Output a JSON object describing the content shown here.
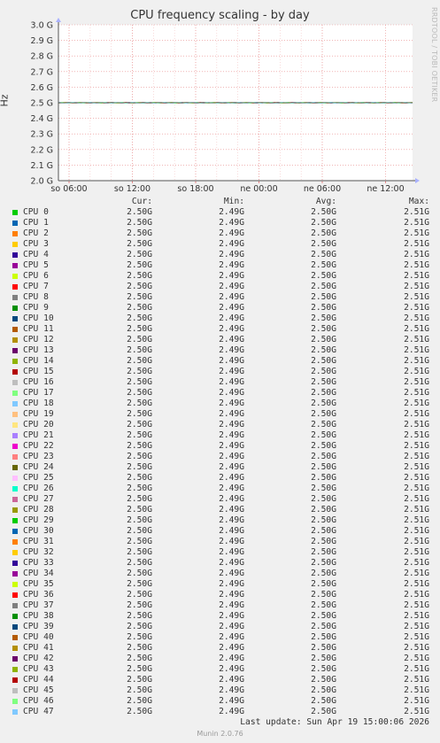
{
  "chart_data": {
    "type": "line",
    "title": "CPU frequency scaling - by day",
    "ylabel": "Hz",
    "ylim": [
      2.0,
      3.0
    ],
    "yticks": [
      {
        "v": 3.0,
        "label": "3.0 G"
      },
      {
        "v": 2.9,
        "label": "2.9 G"
      },
      {
        "v": 2.8,
        "label": "2.8 G"
      },
      {
        "v": 2.7,
        "label": "2.7 G"
      },
      {
        "v": 2.6,
        "label": "2.6 G"
      },
      {
        "v": 2.5,
        "label": "2.5 G"
      },
      {
        "v": 2.4,
        "label": "2.4 G"
      },
      {
        "v": 2.3,
        "label": "2.3 G"
      },
      {
        "v": 2.2,
        "label": "2.2 G"
      },
      {
        "v": 2.1,
        "label": "2.1 G"
      },
      {
        "v": 2.0,
        "label": "2.0 G"
      }
    ],
    "xticks": [
      "so 06:00",
      "so 12:00",
      "so 18:00",
      "ne 00:00",
      "ne 06:00",
      "ne 12:00"
    ],
    "side_label": "RRDTOOL / TOBI OETIKER",
    "columns": {
      "cur": "Cur:",
      "min": "Min:",
      "avg": "Avg:",
      "max": "Max:"
    },
    "series": [
      {
        "name": "CPU 0",
        "color": "#00cc00",
        "cur": "2.50G",
        "min": "2.49G",
        "avg": "2.50G",
        "max": "2.51G"
      },
      {
        "name": "CPU 1",
        "color": "#0066b3",
        "cur": "2.50G",
        "min": "2.49G",
        "avg": "2.50G",
        "max": "2.51G"
      },
      {
        "name": "CPU 2",
        "color": "#ff8000",
        "cur": "2.50G",
        "min": "2.49G",
        "avg": "2.50G",
        "max": "2.51G"
      },
      {
        "name": "CPU 3",
        "color": "#ffcc00",
        "cur": "2.50G",
        "min": "2.49G",
        "avg": "2.50G",
        "max": "2.51G"
      },
      {
        "name": "CPU 4",
        "color": "#330099",
        "cur": "2.50G",
        "min": "2.49G",
        "avg": "2.50G",
        "max": "2.51G"
      },
      {
        "name": "CPU 5",
        "color": "#990099",
        "cur": "2.50G",
        "min": "2.49G",
        "avg": "2.50G",
        "max": "2.51G"
      },
      {
        "name": "CPU 6",
        "color": "#ccff00",
        "cur": "2.50G",
        "min": "2.49G",
        "avg": "2.50G",
        "max": "2.51G"
      },
      {
        "name": "CPU 7",
        "color": "#ff0000",
        "cur": "2.50G",
        "min": "2.49G",
        "avg": "2.50G",
        "max": "2.51G"
      },
      {
        "name": "CPU 8",
        "color": "#808080",
        "cur": "2.50G",
        "min": "2.49G",
        "avg": "2.50G",
        "max": "2.51G"
      },
      {
        "name": "CPU 9",
        "color": "#008f00",
        "cur": "2.50G",
        "min": "2.49G",
        "avg": "2.50G",
        "max": "2.51G"
      },
      {
        "name": "CPU 10",
        "color": "#00487d",
        "cur": "2.50G",
        "min": "2.49G",
        "avg": "2.50G",
        "max": "2.51G"
      },
      {
        "name": "CPU 11",
        "color": "#b35a00",
        "cur": "2.50G",
        "min": "2.49G",
        "avg": "2.50G",
        "max": "2.51G"
      },
      {
        "name": "CPU 12",
        "color": "#b38f00",
        "cur": "2.50G",
        "min": "2.49G",
        "avg": "2.50G",
        "max": "2.51G"
      },
      {
        "name": "CPU 13",
        "color": "#6b006b",
        "cur": "2.50G",
        "min": "2.49G",
        "avg": "2.50G",
        "max": "2.51G"
      },
      {
        "name": "CPU 14",
        "color": "#8fb300",
        "cur": "2.50G",
        "min": "2.49G",
        "avg": "2.50G",
        "max": "2.51G"
      },
      {
        "name": "CPU 15",
        "color": "#b30000",
        "cur": "2.50G",
        "min": "2.49G",
        "avg": "2.50G",
        "max": "2.51G"
      },
      {
        "name": "CPU 16",
        "color": "#bebebe",
        "cur": "2.50G",
        "min": "2.49G",
        "avg": "2.50G",
        "max": "2.51G"
      },
      {
        "name": "CPU 17",
        "color": "#80ff80",
        "cur": "2.50G",
        "min": "2.49G",
        "avg": "2.50G",
        "max": "2.51G"
      },
      {
        "name": "CPU 18",
        "color": "#80c9ff",
        "cur": "2.50G",
        "min": "2.49G",
        "avg": "2.50G",
        "max": "2.51G"
      },
      {
        "name": "CPU 19",
        "color": "#ffc080",
        "cur": "2.50G",
        "min": "2.49G",
        "avg": "2.50G",
        "max": "2.51G"
      },
      {
        "name": "CPU 20",
        "color": "#ffe680",
        "cur": "2.50G",
        "min": "2.49G",
        "avg": "2.50G",
        "max": "2.51G"
      },
      {
        "name": "CPU 21",
        "color": "#aa80ff",
        "cur": "2.50G",
        "min": "2.49G",
        "avg": "2.50G",
        "max": "2.51G"
      },
      {
        "name": "CPU 22",
        "color": "#ee00cc",
        "cur": "2.50G",
        "min": "2.49G",
        "avg": "2.50G",
        "max": "2.51G"
      },
      {
        "name": "CPU 23",
        "color": "#ff8080",
        "cur": "2.50G",
        "min": "2.49G",
        "avg": "2.50G",
        "max": "2.51G"
      },
      {
        "name": "CPU 24",
        "color": "#666600",
        "cur": "2.50G",
        "min": "2.49G",
        "avg": "2.50G",
        "max": "2.51G"
      },
      {
        "name": "CPU 25",
        "color": "#ffbfff",
        "cur": "2.50G",
        "min": "2.49G",
        "avg": "2.50G",
        "max": "2.51G"
      },
      {
        "name": "CPU 26",
        "color": "#00ffcc",
        "cur": "2.50G",
        "min": "2.49G",
        "avg": "2.50G",
        "max": "2.51G"
      },
      {
        "name": "CPU 27",
        "color": "#cc6699",
        "cur": "2.50G",
        "min": "2.49G",
        "avg": "2.50G",
        "max": "2.51G"
      },
      {
        "name": "CPU 28",
        "color": "#999900",
        "cur": "2.50G",
        "min": "2.49G",
        "avg": "2.50G",
        "max": "2.51G"
      },
      {
        "name": "CPU 29",
        "color": "#00cc00",
        "cur": "2.50G",
        "min": "2.49G",
        "avg": "2.50G",
        "max": "2.51G"
      },
      {
        "name": "CPU 30",
        "color": "#0066b3",
        "cur": "2.50G",
        "min": "2.49G",
        "avg": "2.50G",
        "max": "2.51G"
      },
      {
        "name": "CPU 31",
        "color": "#ff8000",
        "cur": "2.50G",
        "min": "2.49G",
        "avg": "2.50G",
        "max": "2.51G"
      },
      {
        "name": "CPU 32",
        "color": "#ffcc00",
        "cur": "2.50G",
        "min": "2.49G",
        "avg": "2.50G",
        "max": "2.51G"
      },
      {
        "name": "CPU 33",
        "color": "#330099",
        "cur": "2.50G",
        "min": "2.49G",
        "avg": "2.50G",
        "max": "2.51G"
      },
      {
        "name": "CPU 34",
        "color": "#990099",
        "cur": "2.50G",
        "min": "2.49G",
        "avg": "2.50G",
        "max": "2.51G"
      },
      {
        "name": "CPU 35",
        "color": "#ccff00",
        "cur": "2.50G",
        "min": "2.49G",
        "avg": "2.50G",
        "max": "2.51G"
      },
      {
        "name": "CPU 36",
        "color": "#ff0000",
        "cur": "2.50G",
        "min": "2.49G",
        "avg": "2.50G",
        "max": "2.51G"
      },
      {
        "name": "CPU 37",
        "color": "#808080",
        "cur": "2.50G",
        "min": "2.49G",
        "avg": "2.50G",
        "max": "2.51G"
      },
      {
        "name": "CPU 38",
        "color": "#008f00",
        "cur": "2.50G",
        "min": "2.49G",
        "avg": "2.50G",
        "max": "2.51G"
      },
      {
        "name": "CPU 39",
        "color": "#00487d",
        "cur": "2.50G",
        "min": "2.49G",
        "avg": "2.50G",
        "max": "2.51G"
      },
      {
        "name": "CPU 40",
        "color": "#b35a00",
        "cur": "2.50G",
        "min": "2.49G",
        "avg": "2.50G",
        "max": "2.51G"
      },
      {
        "name": "CPU 41",
        "color": "#b38f00",
        "cur": "2.50G",
        "min": "2.49G",
        "avg": "2.50G",
        "max": "2.51G"
      },
      {
        "name": "CPU 42",
        "color": "#6b006b",
        "cur": "2.50G",
        "min": "2.49G",
        "avg": "2.50G",
        "max": "2.51G"
      },
      {
        "name": "CPU 43",
        "color": "#8fb300",
        "cur": "2.50G",
        "min": "2.49G",
        "avg": "2.50G",
        "max": "2.51G"
      },
      {
        "name": "CPU 44",
        "color": "#b30000",
        "cur": "2.50G",
        "min": "2.49G",
        "avg": "2.50G",
        "max": "2.51G"
      },
      {
        "name": "CPU 45",
        "color": "#bebebe",
        "cur": "2.50G",
        "min": "2.49G",
        "avg": "2.50G",
        "max": "2.51G"
      },
      {
        "name": "CPU 46",
        "color": "#80ff80",
        "cur": "2.50G",
        "min": "2.49G",
        "avg": "2.50G",
        "max": "2.51G"
      },
      {
        "name": "CPU 47",
        "color": "#80c9ff",
        "cur": "2.50G",
        "min": "2.49G",
        "avg": "2.50G",
        "max": "2.51G"
      }
    ]
  },
  "last_update": "Last update: Sun Apr 19 15:00:06 2026",
  "footer": "Munin 2.0.76"
}
